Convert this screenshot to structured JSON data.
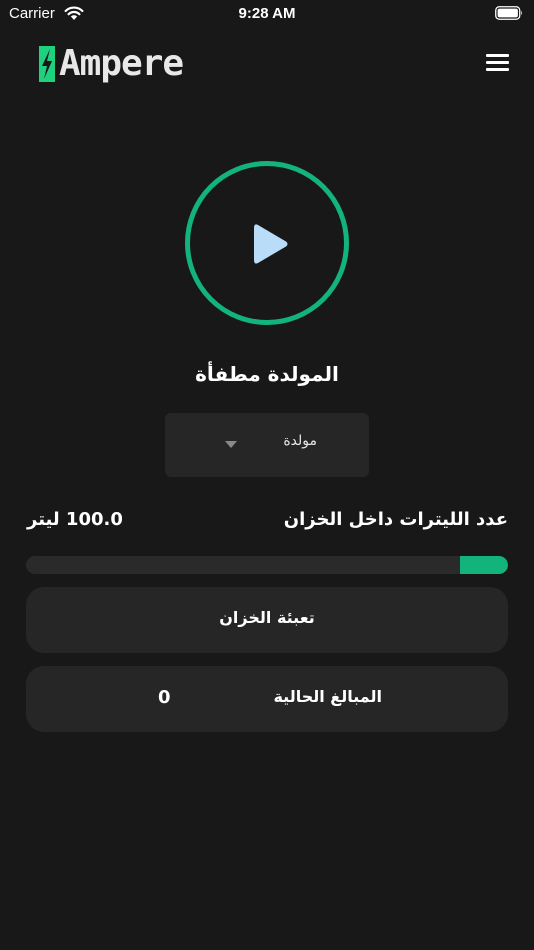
{
  "status_bar": {
    "carrier": "Carrier",
    "time": "9:28 AM",
    "wifi_icon": "wifi-icon",
    "battery_icon": "battery-icon"
  },
  "header": {
    "app_name": "Ampere",
    "logo_icon": "lightning-bolt-icon",
    "menu_icon": "hamburger-menu-icon"
  },
  "power": {
    "icon": "play-icon",
    "status_text": "المولدة مطفأة"
  },
  "generator_select": {
    "selected": "مولدة",
    "arrow_icon": "caret-down-icon"
  },
  "tank": {
    "label": "عدد الليترات داخل الخزان",
    "value": "100.0 ليتر",
    "fill_fraction": 0.1
  },
  "fill_tank_button": {
    "label": "تعبئة الخزان"
  },
  "current_amount": {
    "label": "المبالغ الحالية",
    "value": "0"
  },
  "colors": {
    "background": "#181818",
    "card": "#262626",
    "accent": "#13b47c",
    "play": "#b9dcf9",
    "bolt": "#1fd07f"
  }
}
